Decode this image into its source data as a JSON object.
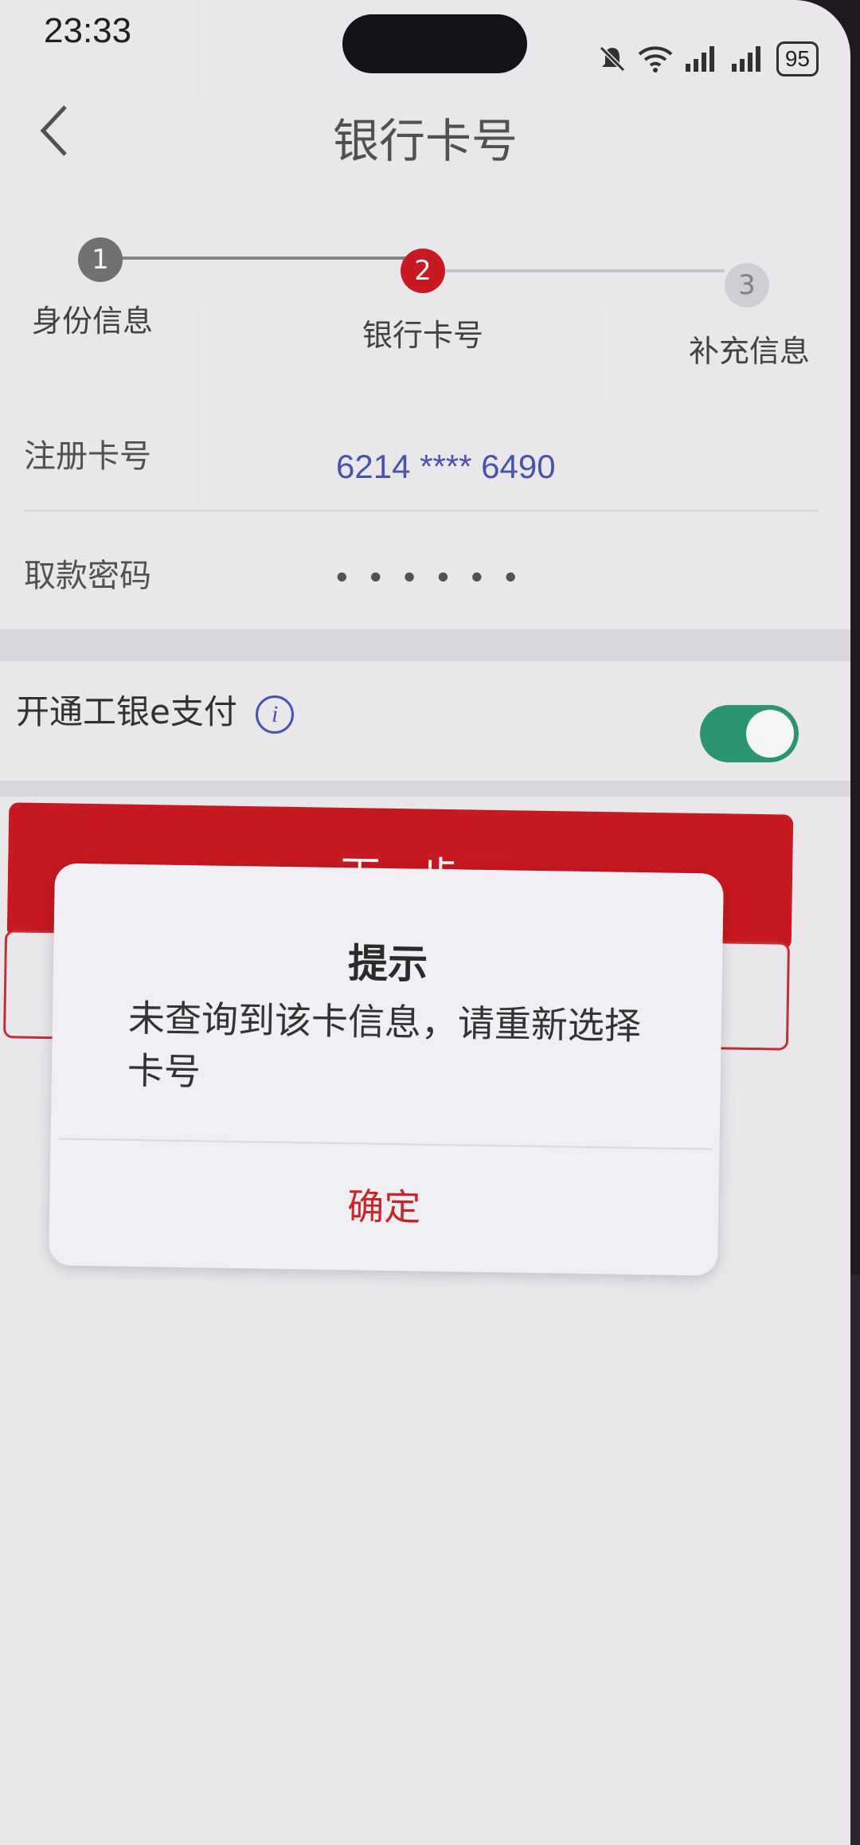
{
  "status_bar": {
    "time": "23:33",
    "battery": "95",
    "icons": [
      "mute-bell-icon",
      "wifi-icon",
      "signal-icon",
      "signal-icon",
      "battery-icon"
    ]
  },
  "nav": {
    "back_icon": "chevron-left-icon",
    "title": "银行卡号"
  },
  "stepper": {
    "steps": [
      {
        "number": "1",
        "label": "身份信息",
        "state": "done",
        "color": "#7a7a7a"
      },
      {
        "number": "2",
        "label": "银行卡号",
        "state": "current",
        "color": "#d01b24"
      },
      {
        "number": "3",
        "label": "补充信息",
        "state": "pending",
        "color": "#d7d5d9"
      }
    ]
  },
  "form": {
    "card_label": "注册卡号",
    "card_value": "6214 **** 6490",
    "password_label": "取款密码",
    "password_value": "• • • • • •"
  },
  "epay": {
    "label": "开通工银e支付",
    "info_icon": "info-icon",
    "enabled": true,
    "toggle_color": "#2e9a78"
  },
  "buttons": {
    "next_label": "下一步"
  },
  "dialog": {
    "title": "提示",
    "message": "未查询到该卡信息，请重新选择卡号",
    "confirm_label": "确定",
    "accent": "#c8262d"
  }
}
